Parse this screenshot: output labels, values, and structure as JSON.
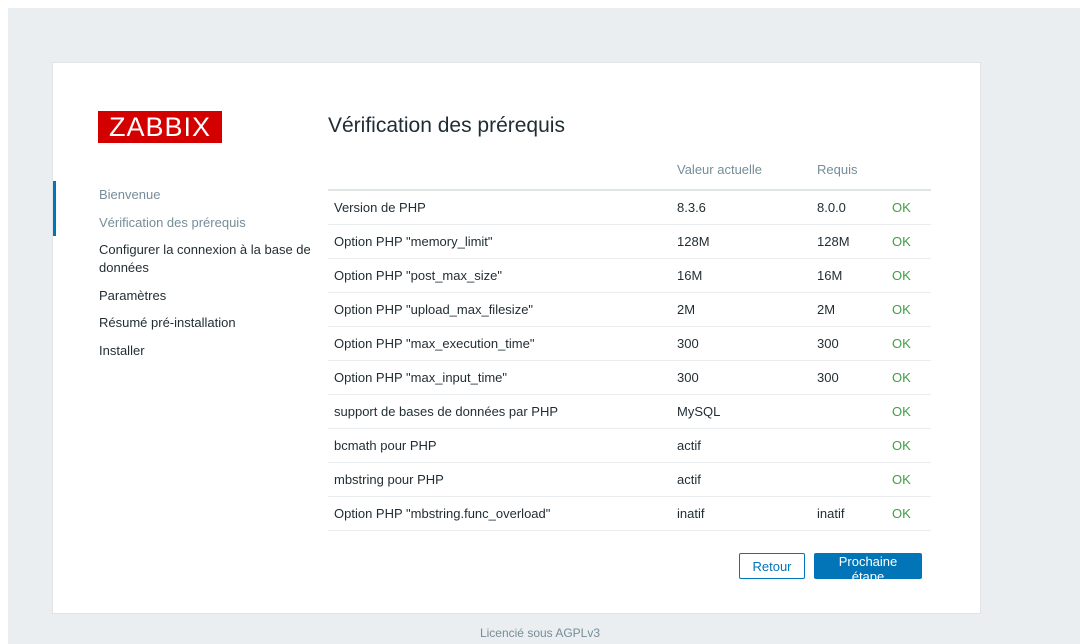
{
  "logo": "ZABBIX",
  "page_title": "Vérification des prérequis",
  "nav": [
    {
      "label": "Bienvenue",
      "state": "done"
    },
    {
      "label": "Vérification des prérequis",
      "state": "current"
    },
    {
      "label": "Configurer la connexion à la base de données",
      "state": "pending"
    },
    {
      "label": "Paramètres",
      "state": "pending"
    },
    {
      "label": "Résumé pré-installation",
      "state": "pending"
    },
    {
      "label": "Installer",
      "state": "pending"
    }
  ],
  "table": {
    "headers": [
      "",
      "Valeur actuelle",
      "Requis",
      ""
    ],
    "rows": [
      {
        "name": "Version de PHP",
        "current": "8.3.6",
        "required": "8.0.0",
        "status": "OK"
      },
      {
        "name": "Option PHP \"memory_limit\"",
        "current": "128M",
        "required": "128M",
        "status": "OK"
      },
      {
        "name": "Option PHP \"post_max_size\"",
        "current": "16M",
        "required": "16M",
        "status": "OK"
      },
      {
        "name": "Option PHP \"upload_max_filesize\"",
        "current": "2M",
        "required": "2M",
        "status": "OK"
      },
      {
        "name": "Option PHP \"max_execution_time\"",
        "current": "300",
        "required": "300",
        "status": "OK"
      },
      {
        "name": "Option PHP \"max_input_time\"",
        "current": "300",
        "required": "300",
        "status": "OK"
      },
      {
        "name": "support de bases de données par PHP",
        "current": "MySQL",
        "required": "",
        "status": "OK"
      },
      {
        "name": "bcmath pour PHP",
        "current": "actif",
        "required": "",
        "status": "OK"
      },
      {
        "name": "mbstring pour PHP",
        "current": "actif",
        "required": "",
        "status": "OK"
      },
      {
        "name": "Option PHP \"mbstring.func_overload\"",
        "current": "inatif",
        "required": "inatif",
        "status": "OK"
      }
    ]
  },
  "buttons": {
    "back": "Retour",
    "next": "Prochaine étape"
  },
  "footer": "Licencié sous AGPLv3",
  "colors": {
    "brand": "#d40000",
    "accent": "#0275b8",
    "ok": "#429e47"
  }
}
